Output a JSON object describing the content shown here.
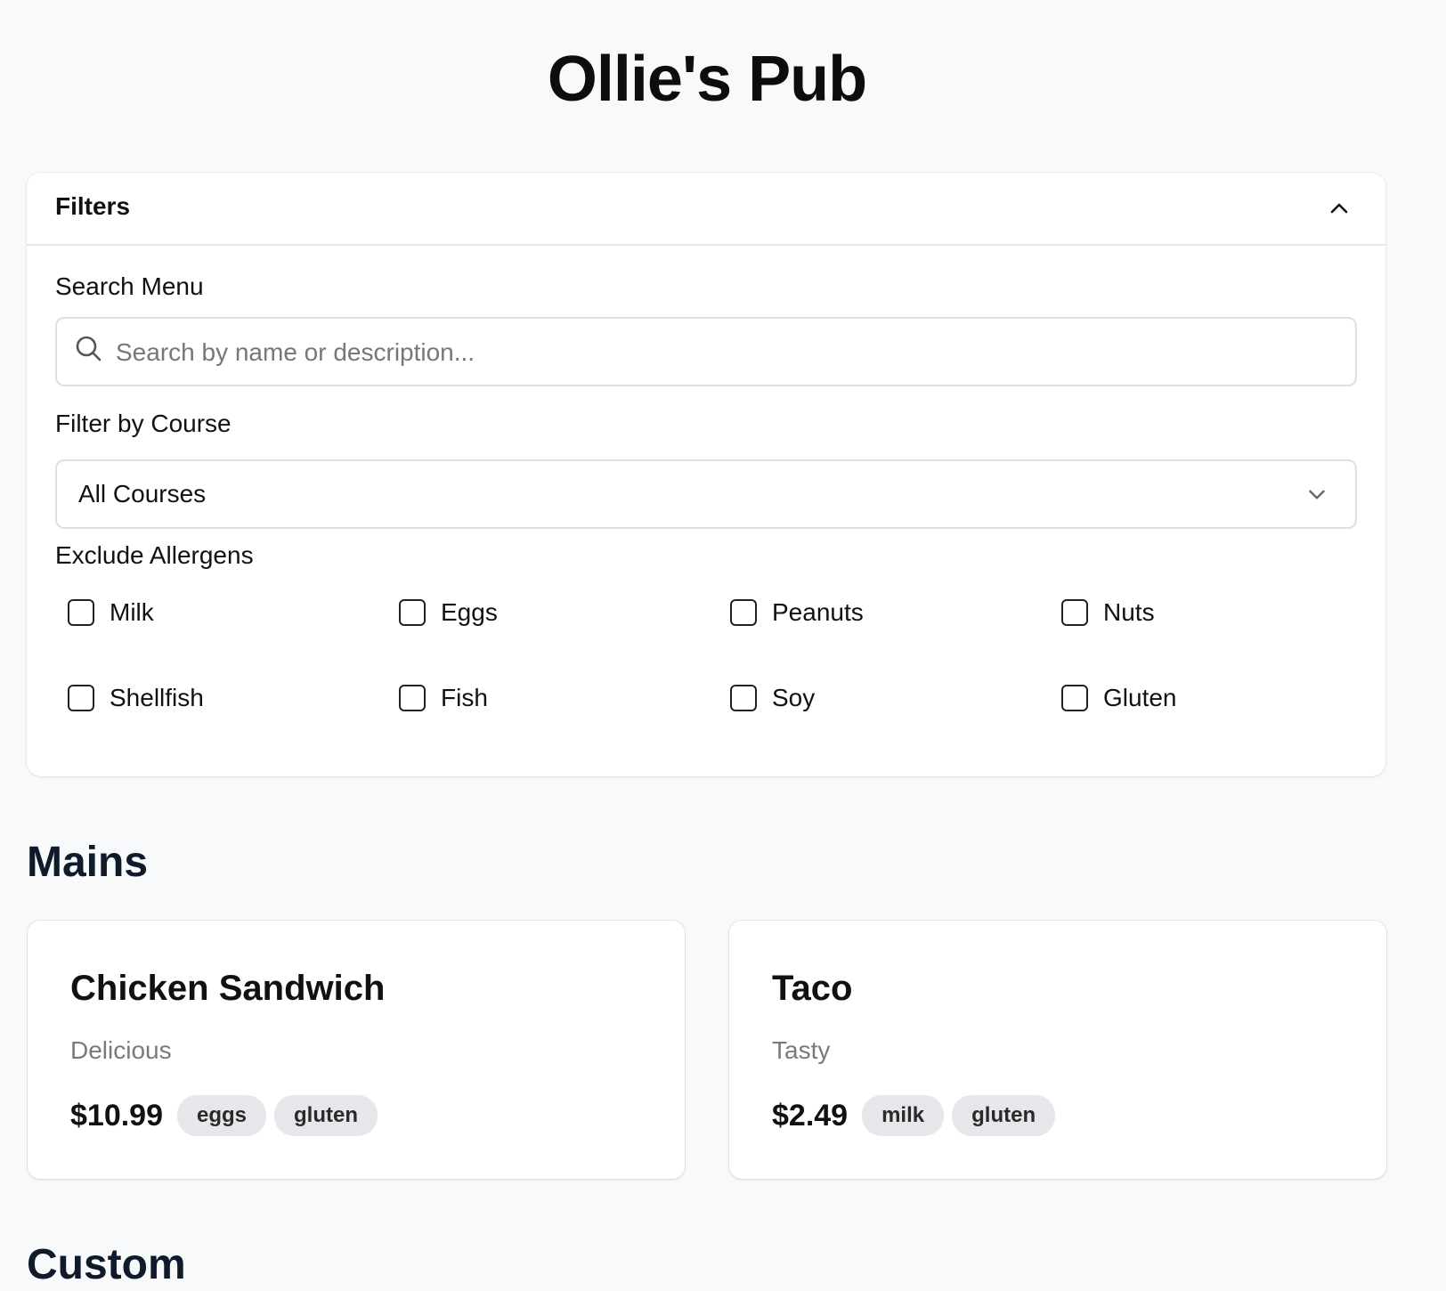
{
  "header": {
    "title": "Ollie's Pub"
  },
  "filters": {
    "title": "Filters",
    "search": {
      "label": "Search Menu",
      "placeholder": "Search by name or description...",
      "value": ""
    },
    "course": {
      "label": "Filter by Course",
      "selected": "All Courses"
    },
    "allergens": {
      "label": "Exclude Allergens",
      "items": [
        {
          "label": "Milk",
          "checked": false
        },
        {
          "label": "Eggs",
          "checked": false
        },
        {
          "label": "Peanuts",
          "checked": false
        },
        {
          "label": "Nuts",
          "checked": false
        },
        {
          "label": "Shellfish",
          "checked": false
        },
        {
          "label": "Fish",
          "checked": false
        },
        {
          "label": "Soy",
          "checked": false
        },
        {
          "label": "Gluten",
          "checked": false
        }
      ]
    }
  },
  "sections": [
    {
      "title": "Mains",
      "items": [
        {
          "name": "Chicken Sandwich",
          "description": "Delicious",
          "price": "$10.99",
          "tags": [
            "eggs",
            "gluten"
          ]
        },
        {
          "name": "Taco",
          "description": "Tasty",
          "price": "$2.49",
          "tags": [
            "milk",
            "gluten"
          ]
        }
      ]
    },
    {
      "title": "Custom",
      "items": []
    }
  ],
  "icons": {
    "collapse": "chevron-up-icon",
    "search": "search-icon",
    "select": "chevron-down-icon"
  }
}
